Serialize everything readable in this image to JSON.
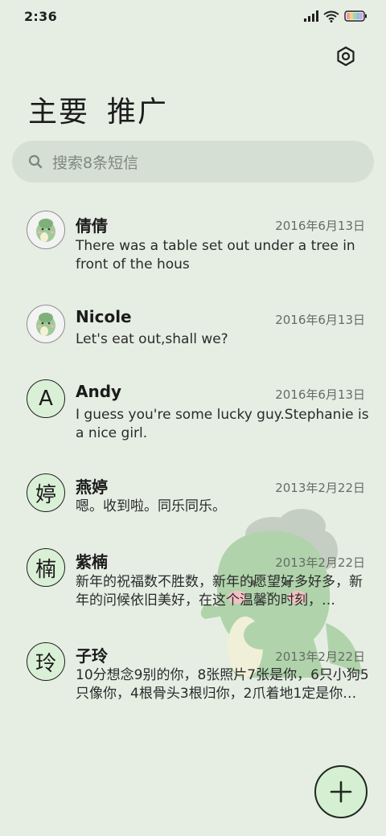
{
  "status": {
    "time": "2:36"
  },
  "tabs": [
    {
      "label": "主要"
    },
    {
      "label": "推广"
    }
  ],
  "search": {
    "placeholder": "搜索8条短信"
  },
  "conversations": [
    {
      "name": "倩倩",
      "date": "2016年6月13日",
      "snippet": "There was a table set out under a tree in front of the hous",
      "avatar_type": "dino-image"
    },
    {
      "name": "Nicole",
      "date": "2016年6月13日",
      "snippet": "Let's eat out,shall we?",
      "avatar_type": "dino-image"
    },
    {
      "name": "Andy",
      "date": "2016年6月13日",
      "snippet": "I guess you're some lucky guy.Stephanie is a nice girl.",
      "avatar_letter": "A"
    },
    {
      "name": "燕婷",
      "date": "2013年2月22日",
      "snippet": "嗯。收到啦。同乐同乐。",
      "avatar_letter": "婷"
    },
    {
      "name": "紫楠",
      "date": "2013年2月22日",
      "snippet": "新年的祝福数不胜数，新年的愿望好多好多，新年的问候依旧美好，在这个温馨的时刻，…",
      "avatar_letter": "楠"
    },
    {
      "name": "子玲",
      "date": "2013年2月22日",
      "snippet": "10分想念9别的你，8张照片7张是你，6只小狗5只像你，4根骨头3根归你，2爪着地1定是你…",
      "avatar_letter": "玲"
    }
  ],
  "icons": {
    "signal": "signal-icon",
    "wifi": "wifi-icon",
    "battery": "battery-icon",
    "settings": "settings-icon",
    "search": "search-icon",
    "add": "plus-icon"
  },
  "colors": {
    "background": "#e6eee4",
    "search_bg": "#d5dfd3",
    "avatar_bg": "#daf0d6",
    "fab_bg": "#d4efd2"
  }
}
